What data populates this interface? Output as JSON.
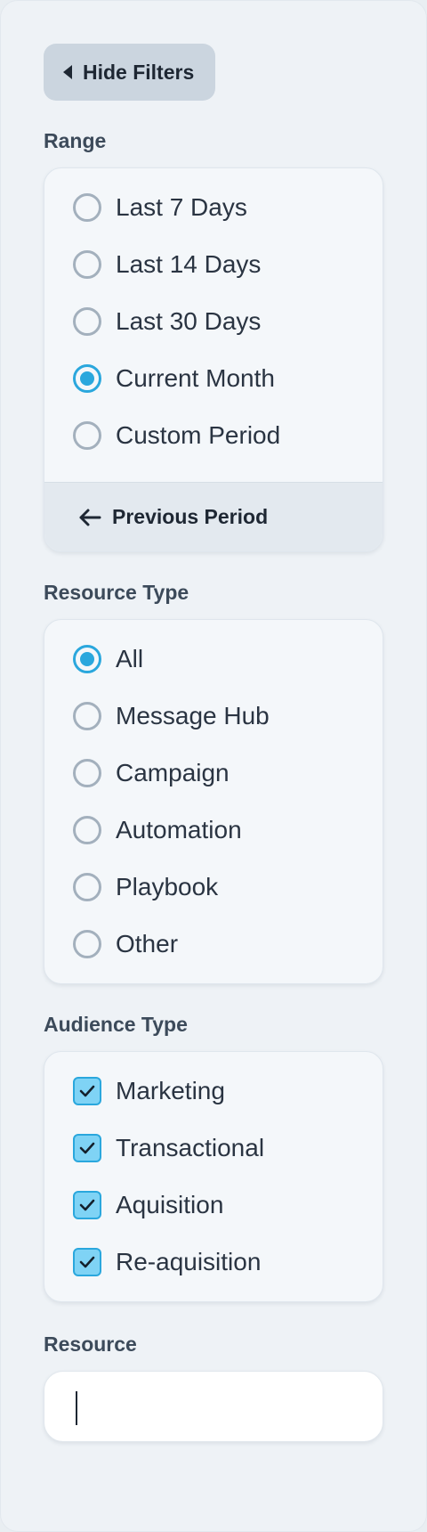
{
  "toggle": {
    "label": "Hide Filters"
  },
  "range": {
    "label": "Range",
    "options": [
      {
        "label": "Last 7 Days",
        "selected": false
      },
      {
        "label": "Last 14 Days",
        "selected": false
      },
      {
        "label": "Last 30 Days",
        "selected": false
      },
      {
        "label": "Current Month",
        "selected": true
      },
      {
        "label": "Custom Period",
        "selected": false
      }
    ],
    "previous_label": "Previous Period"
  },
  "resource_type": {
    "label": "Resource Type",
    "options": [
      {
        "label": "All",
        "selected": true
      },
      {
        "label": "Message Hub",
        "selected": false
      },
      {
        "label": "Campaign",
        "selected": false
      },
      {
        "label": "Automation",
        "selected": false
      },
      {
        "label": "Playbook",
        "selected": false
      },
      {
        "label": "Other",
        "selected": false
      }
    ]
  },
  "audience_type": {
    "label": "Audience Type",
    "options": [
      {
        "label": "Marketing",
        "checked": true
      },
      {
        "label": "Transactional",
        "checked": true
      },
      {
        "label": "Aquisition",
        "checked": true
      },
      {
        "label": "Re-aquisition",
        "checked": true
      }
    ]
  },
  "resource": {
    "label": "Resource",
    "value": "",
    "placeholder": ""
  },
  "colors": {
    "accent": "#2aa7dd",
    "checkbox_fill": "#7fd3f5",
    "panel_bg": "#eef2f6"
  }
}
